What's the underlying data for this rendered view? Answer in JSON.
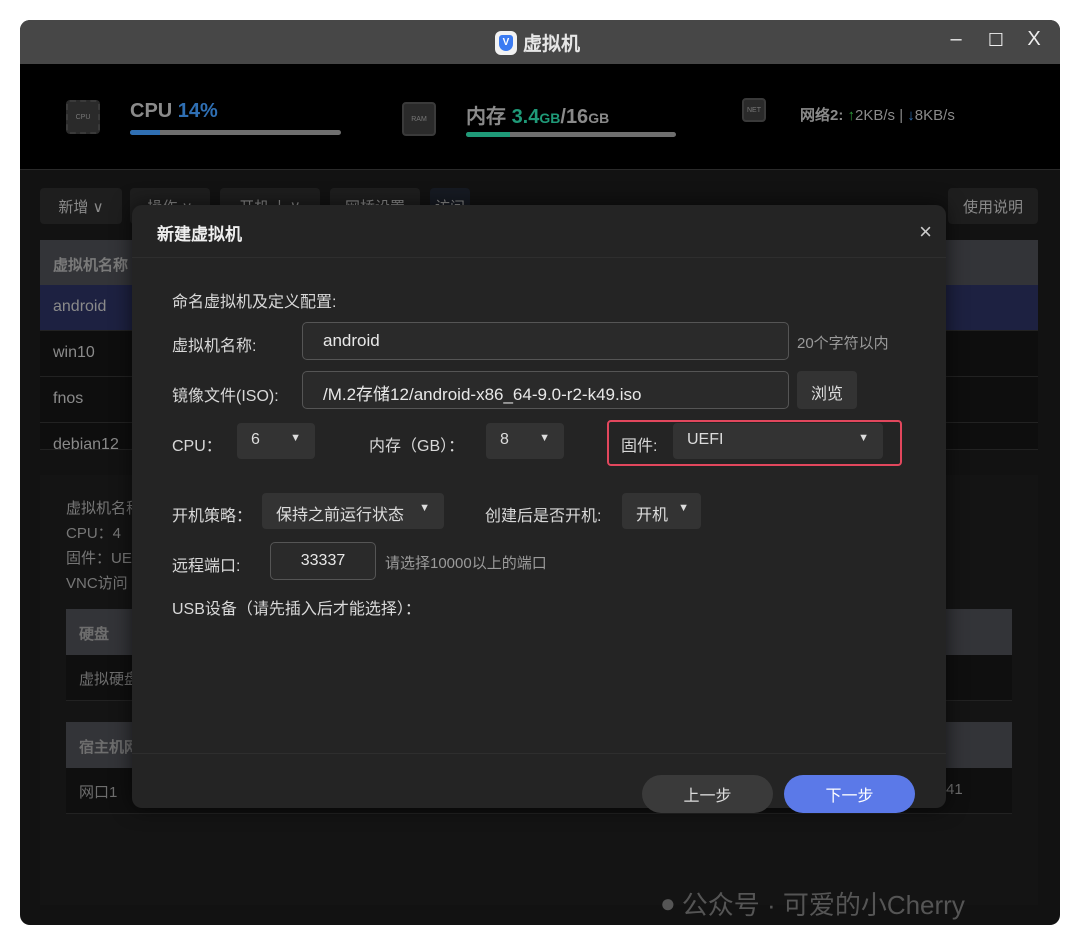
{
  "window": {
    "title": "虚拟机",
    "logo_letter": "V",
    "minimize": "‒",
    "maximize": "☐",
    "close": "X"
  },
  "stats": {
    "cpu_label": "CPU",
    "cpu_value": "14%",
    "cpu_percent": 14,
    "cpu_chip": "CPU",
    "mem_label": "内存",
    "mem_used": "3.4",
    "mem_used_unit": "GB",
    "mem_sep": "/",
    "mem_total": "16",
    "mem_total_unit": "GB",
    "mem_percent": 21,
    "ram_chip": "RAM",
    "net_chip": "NET",
    "net_label": "网络2:",
    "net_up": "2KB/s",
    "net_sep": "|",
    "net_down": "8KB/s",
    "up_arrow": "↑",
    "down_arrow": "↓"
  },
  "toolbar": {
    "add": "新增 ∨",
    "ops": "操作 ∨",
    "power": "开机",
    "power_caret": "∨",
    "bridge": "网桥设置",
    "access": "访问",
    "help": "使用说明"
  },
  "vm_table": {
    "header": "虚拟机名称",
    "rows": [
      "android",
      "win10",
      "fnos",
      "debian12"
    ]
  },
  "detail": {
    "lines": [
      "虚拟机名称",
      "CPU：4",
      "固件：UE",
      "VNC访问"
    ],
    "disk_header": "硬盘",
    "disk_row": "虚拟硬盘",
    "host_header": "宿主机网",
    "host_row": "网口1",
    "host_tail": "41"
  },
  "modal": {
    "title": "新建虚拟机",
    "close": "×",
    "section": "命名虚拟机及定义配置:",
    "name_label": "虚拟机名称:",
    "name_value": "android",
    "name_hint": "20个字符以内",
    "iso_label": "镜像文件(ISO):",
    "iso_value": "/M.2存储12/android-x86_64-9.0-r2-k49.iso",
    "browse": "浏览",
    "cpu_label": "CPU：",
    "cpu_value": "6",
    "mem_label": "内存（GB）：",
    "mem_value": "8",
    "fw_label": "固件:",
    "fw_value": "UEFI",
    "boot_label": "开机策略：",
    "boot_value": "保持之前运行状态",
    "autostart_label": "创建后是否开机:",
    "autostart_value": "开机",
    "port_label": "远程端口:",
    "port_value": "33337",
    "port_hint": "请选择10000以上的端口",
    "usb_label": "USB设备（请先插入后才能选择）：",
    "prev": "上一步",
    "next": "下一步",
    "caret": "▼"
  },
  "watermark": "公众号 · 可爱的小Cherry",
  "colors": {
    "accent": "#5b79e8",
    "highlight": "#e2475d",
    "cpu": "#2f6fb3",
    "mem": "#1f9a78"
  }
}
